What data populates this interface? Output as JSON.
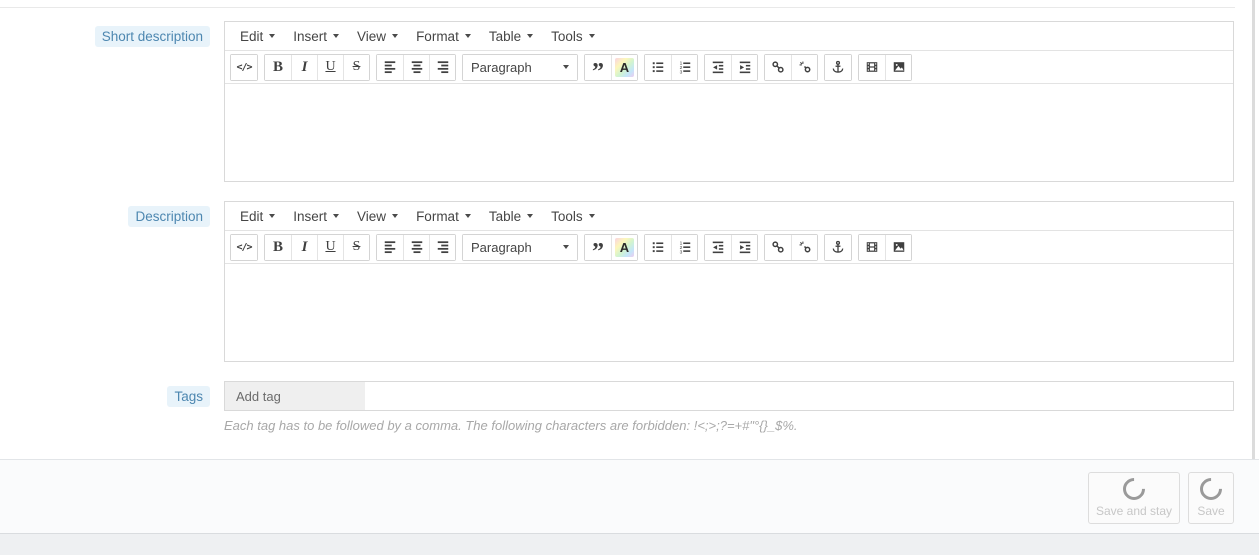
{
  "labels": {
    "short_description": "Short description",
    "description": "Description",
    "tags": "Tags"
  },
  "editor": {
    "menus": [
      "Edit",
      "Insert",
      "View",
      "Format",
      "Table",
      "Tools"
    ],
    "toolbar": {
      "source_code": "</>",
      "bold": "B",
      "italic": "I",
      "underline": "U",
      "strikethrough": "S",
      "paragraph_label": "Paragraph",
      "blockquote": "”",
      "text_color": "A",
      "icon_names": [
        "source-code-icon",
        "bold-icon",
        "italic-icon",
        "underline-icon",
        "strikethrough-icon",
        "align-left-icon",
        "align-center-icon",
        "align-right-icon",
        "paragraph-format-select",
        "blockquote-icon",
        "text-color-icon",
        "unordered-list-icon",
        "ordered-list-icon",
        "outdent-icon",
        "indent-icon",
        "link-icon",
        "unlink-icon",
        "anchor-icon",
        "media-icon",
        "image-icon"
      ]
    },
    "content": ""
  },
  "tags_field": {
    "placeholder": "Add tag",
    "value": "",
    "help_text": "Each tag has to be followed by a comma. The following characters are forbidden: !<;>;?=+#\"°{}_$%."
  },
  "footer": {
    "save_and_stay_label": "Save and stay",
    "save_label": "Save"
  },
  "colors": {
    "label_text": "#4d87b0",
    "label_bg": "#e8f3fa",
    "border": "#d9d9d9",
    "footer_bg": "#fafbfc",
    "page_bottom_bg": "#eef0f2",
    "disabled_text": "#c7c7c7",
    "spinner": "#9a9a9a"
  }
}
